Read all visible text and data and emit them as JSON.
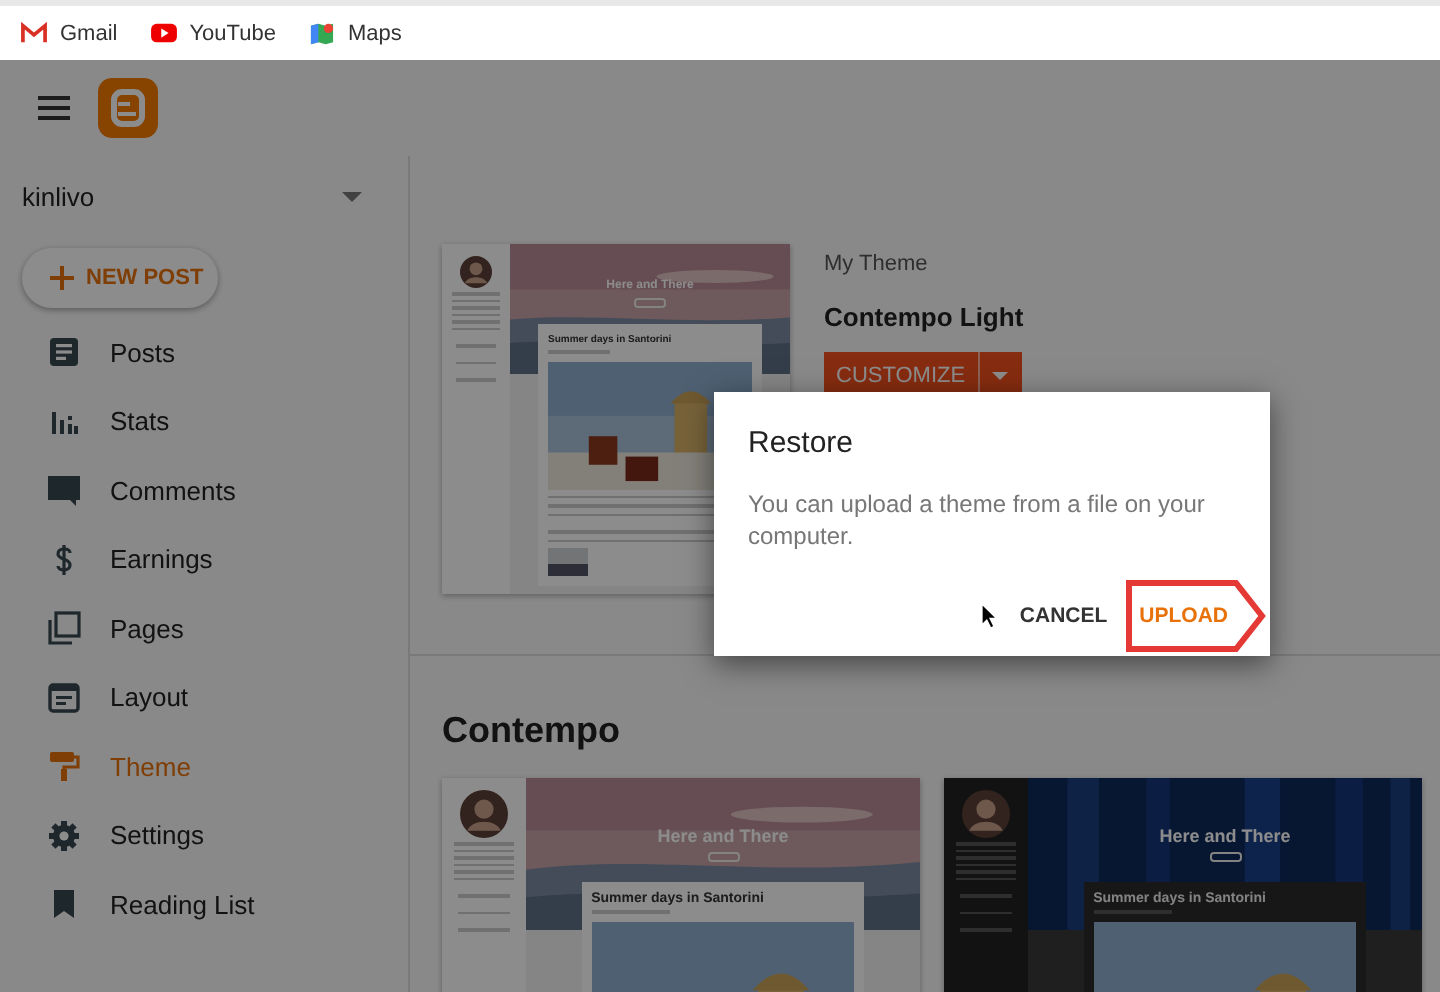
{
  "bookmarks": [
    {
      "label": "Gmail",
      "kind": "gmail"
    },
    {
      "label": "YouTube",
      "kind": "youtube"
    },
    {
      "label": "Maps",
      "kind": "maps"
    }
  ],
  "blog": {
    "name": "kinlivo"
  },
  "new_post": {
    "label": "NEW POST"
  },
  "nav": [
    {
      "label": "Posts",
      "kind": "posts",
      "selected": false
    },
    {
      "label": "Stats",
      "kind": "stats",
      "selected": false
    },
    {
      "label": "Comments",
      "kind": "comments",
      "selected": false
    },
    {
      "label": "Earnings",
      "kind": "earnings",
      "selected": false
    },
    {
      "label": "Pages",
      "kind": "pages",
      "selected": false
    },
    {
      "label": "Layout",
      "kind": "layout",
      "selected": false
    },
    {
      "label": "Theme",
      "kind": "theme",
      "selected": true
    },
    {
      "label": "Settings",
      "kind": "settings",
      "selected": false
    },
    {
      "label": "Reading List",
      "kind": "reading",
      "selected": false
    }
  ],
  "my_theme": {
    "caption": "My Theme",
    "name": "Contempo Light",
    "customize": "CUSTOMIZE",
    "preview": {
      "kind": "light",
      "title": "Here and There",
      "post_title": "Summer days in Santorini"
    }
  },
  "section": {
    "title": "Contempo",
    "themes": [
      {
        "kind": "light",
        "title": "Here and There",
        "post_title": "Summer days in Santorini"
      },
      {
        "kind": "dark",
        "title": "Here and There",
        "post_title": "Summer days in Santorini"
      }
    ]
  },
  "dialog": {
    "title": "Restore",
    "message": "You can upload a theme from a file on your computer.",
    "buttons": [
      {
        "label": "CANCEL",
        "highlighted": false
      },
      {
        "label": "UPLOAD",
        "highlighted": true
      }
    ]
  }
}
